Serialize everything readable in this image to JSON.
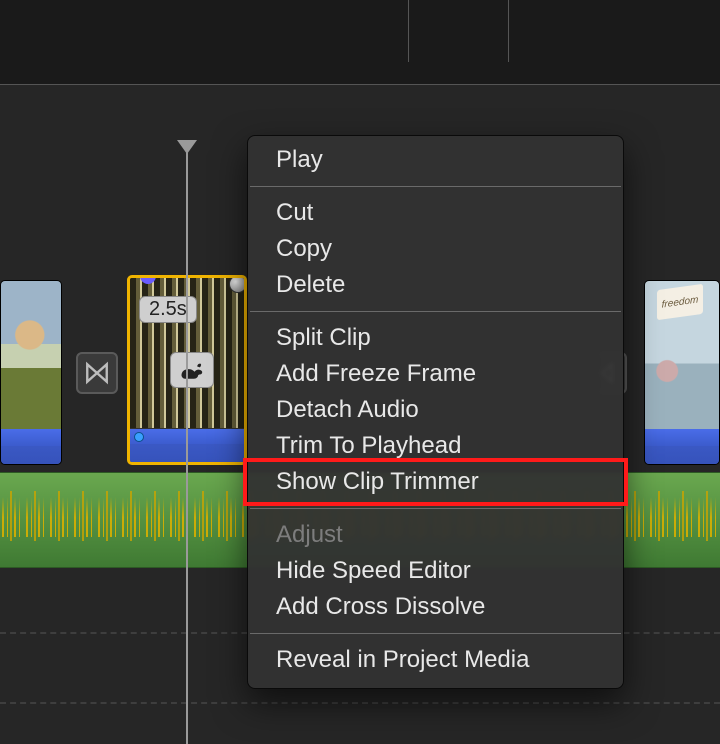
{
  "clip": {
    "duration_label": "2.5s",
    "right_flag_text": "freedom"
  },
  "menu": {
    "items": [
      {
        "label": "Play",
        "enabled": true
      },
      {
        "sep": true
      },
      {
        "label": "Cut",
        "enabled": true
      },
      {
        "label": "Copy",
        "enabled": true
      },
      {
        "label": "Delete",
        "enabled": true
      },
      {
        "sep": true
      },
      {
        "label": "Split Clip",
        "enabled": true
      },
      {
        "label": "Add Freeze Frame",
        "enabled": true
      },
      {
        "label": "Detach Audio",
        "enabled": true
      },
      {
        "label": "Trim To Playhead",
        "enabled": true
      },
      {
        "label": "Show Clip Trimmer",
        "enabled": true,
        "highlighted": true
      },
      {
        "sep": true
      },
      {
        "label": "Adjust",
        "enabled": false
      },
      {
        "label": "Hide Speed Editor",
        "enabled": true
      },
      {
        "label": "Add Cross Dissolve",
        "enabled": true
      },
      {
        "sep": true
      },
      {
        "label": "Reveal in Project Media",
        "enabled": true
      }
    ]
  }
}
